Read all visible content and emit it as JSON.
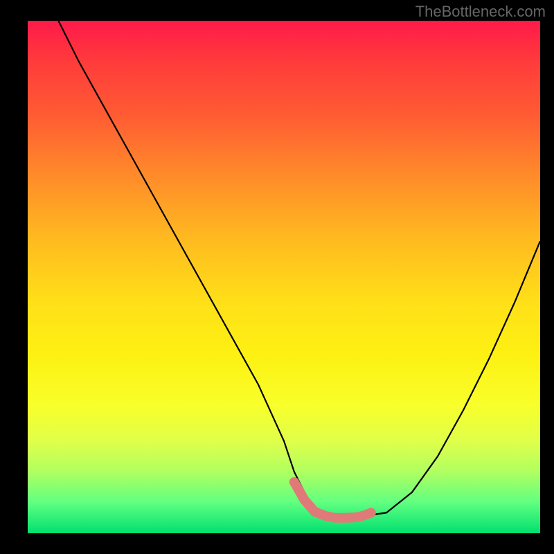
{
  "watermark": "TheBottleneck.com",
  "chart_data": {
    "type": "line",
    "title": "",
    "xlabel": "",
    "ylabel": "",
    "xlim": [
      0,
      100
    ],
    "ylim": [
      0,
      100
    ],
    "series": [
      {
        "name": "black-curve",
        "color": "#000000",
        "x": [
          6,
          10,
          15,
          20,
          25,
          30,
          35,
          40,
          45,
          50,
          52,
          55,
          58,
          60,
          62,
          65,
          70,
          75,
          80,
          85,
          90,
          95,
          100
        ],
        "values": [
          100,
          92,
          83,
          74,
          65,
          56,
          47,
          38,
          29,
          18,
          12,
          6,
          3.5,
          3,
          3,
          3.3,
          4,
          8,
          15,
          24,
          34,
          45,
          57
        ]
      },
      {
        "name": "salmon-marker-band",
        "color": "#e07a78",
        "x": [
          52,
          54,
          56,
          58,
          60,
          62,
          64,
          65,
          66,
          67
        ],
        "values": [
          10,
          6.5,
          4.2,
          3.4,
          3,
          3,
          3.1,
          3.3,
          3.6,
          4
        ]
      }
    ],
    "gradient_stops": [
      {
        "pos": 0.0,
        "color": "#ff1a4a"
      },
      {
        "pos": 0.5,
        "color": "#ffe018"
      },
      {
        "pos": 0.95,
        "color": "#60ff80"
      },
      {
        "pos": 1.0,
        "color": "#00e070"
      }
    ]
  }
}
